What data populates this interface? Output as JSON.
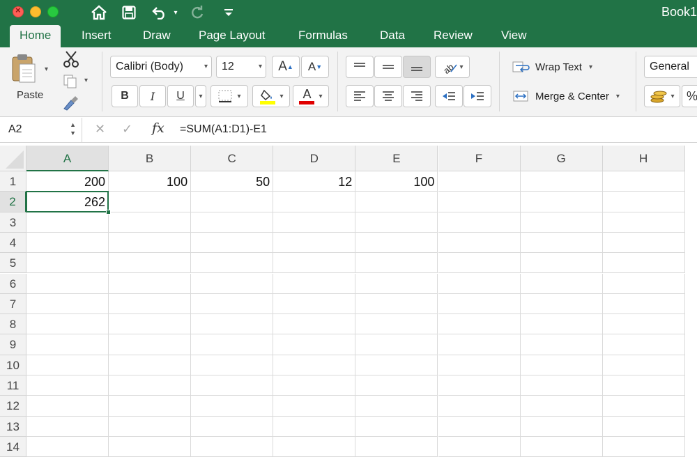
{
  "window": {
    "title": "Book1"
  },
  "tabs": [
    "Home",
    "Insert",
    "Draw",
    "Page Layout",
    "Formulas",
    "Data",
    "Review",
    "View"
  ],
  "ribbon": {
    "paste_label": "Paste",
    "font_name": "Calibri (Body)",
    "font_size": "12",
    "increase_font": "A",
    "decrease_font": "A",
    "bold": "B",
    "italic": "I",
    "underline": "U",
    "fill_letter": "",
    "font_color_letter": "A",
    "wrap_text": "Wrap Text",
    "merge_center": "Merge & Center",
    "number_format": "General",
    "percent": "%"
  },
  "formula_bar": {
    "name_box": "A2",
    "fx": "fx",
    "formula": "=SUM(A1:D1)-E1"
  },
  "sheet": {
    "columns": [
      "A",
      "B",
      "C",
      "D",
      "E",
      "F",
      "G",
      "H"
    ],
    "rows": [
      "1",
      "2",
      "3",
      "4",
      "5",
      "6",
      "7",
      "8",
      "9",
      "10",
      "11",
      "12",
      "13",
      "14"
    ],
    "cells": {
      "A1": "200",
      "B1": "100",
      "C1": "50",
      "D1": "12",
      "E1": "100",
      "A2": "262"
    },
    "active_cell": "A2"
  },
  "colors": {
    "accent": "#217346",
    "fill_swatch": "#ffff00",
    "font_swatch": "#e00000"
  }
}
